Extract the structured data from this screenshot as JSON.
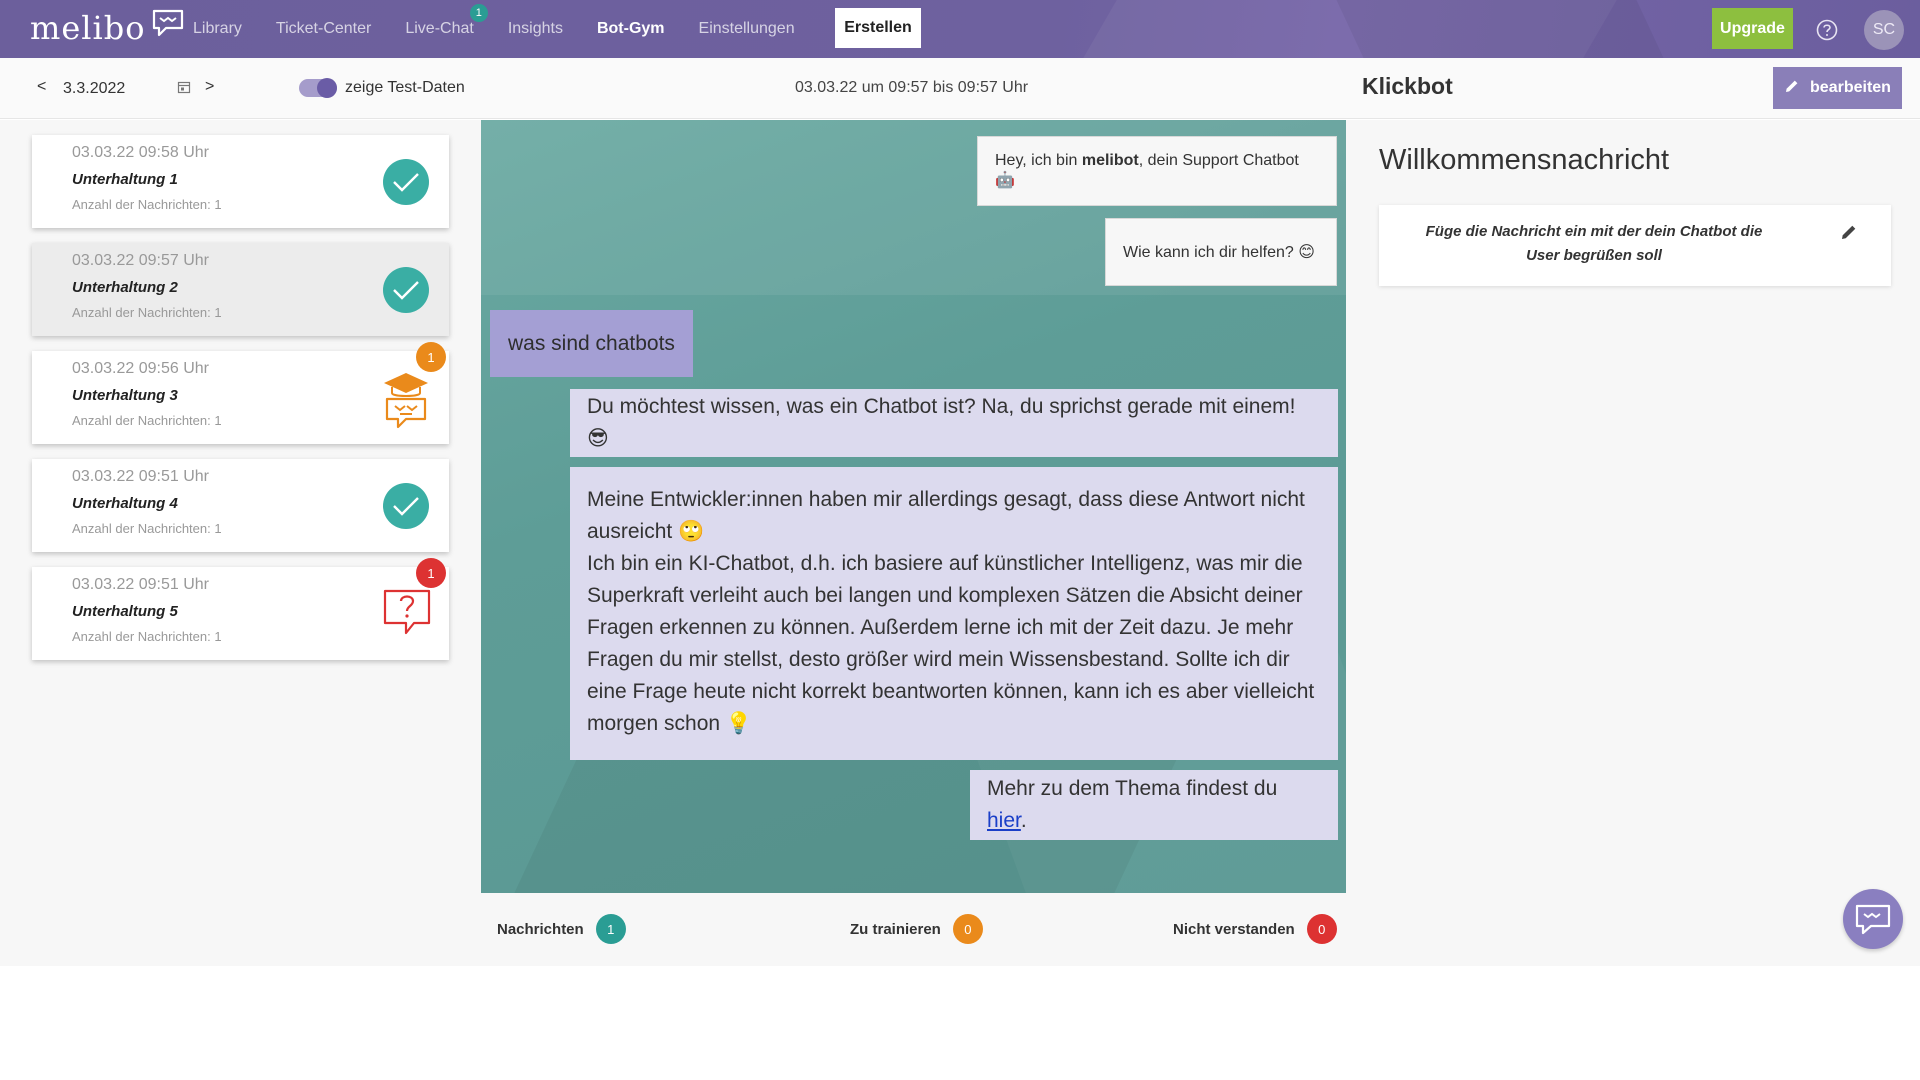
{
  "app": {
    "logo_text": "melibo"
  },
  "nav": {
    "items": [
      {
        "label": "Library",
        "bold": false
      },
      {
        "label": "Ticket-Center",
        "bold": false
      },
      {
        "label": "Live-Chat",
        "bold": false,
        "badge": "1"
      },
      {
        "label": "Insights",
        "bold": false
      },
      {
        "label": "Bot-Gym",
        "bold": true
      },
      {
        "label": "Einstellungen",
        "bold": false
      }
    ],
    "active_label": "Erstellen",
    "upgrade_label": "Upgrade",
    "avatar_initials": "SC"
  },
  "subheader": {
    "prev": "<",
    "date": "3.3.2022",
    "next": ">",
    "toggle_label": "zeige Test-Daten",
    "toggle_on": true,
    "time_range": "03.03.22 um 09:57 bis 09:57 Uhr",
    "bot_name": "Klickbot",
    "edit_label": "bearbeiten"
  },
  "conversations": [
    {
      "time": "03.03.22 09:58 Uhr",
      "title": "Unterhaltung 1",
      "count": "Anzahl der Nachrichten: 1",
      "status": "check"
    },
    {
      "time": "03.03.22 09:57 Uhr",
      "title": "Unterhaltung 2",
      "count": "Anzahl der Nachrichten: 1",
      "status": "check",
      "selected": true
    },
    {
      "time": "03.03.22 09:56 Uhr",
      "title": "Unterhaltung 3",
      "count": "Anzahl der Nachrichten: 1",
      "status": "train",
      "badge": "1"
    },
    {
      "time": "03.03.22 09:51 Uhr",
      "title": "Unterhaltung 4",
      "count": "Anzahl der Nachrichten: 1",
      "status": "check"
    },
    {
      "time": "03.03.22 09:51 Uhr",
      "title": "Unterhaltung 5",
      "count": "Anzahl der Nachrichten: 1",
      "status": "question",
      "badge": "1"
    }
  ],
  "chat": {
    "greeting_pre": "Hey, ich bin ",
    "greeting_bold": "melibot",
    "greeting_post": ", dein Support Chatbot 🤖",
    "help": "Wie kann ich dir helfen? 😊",
    "user_message": "was sind chatbots",
    "answer_1": "Du möchtest wissen, was ein Chatbot ist? Na, du sprichst gerade mit einem! 😎",
    "answer_2_line1": "Meine Entwickler:innen haben mir allerdings gesagt, dass diese Antwort nicht ausreicht 🙄",
    "answer_2_line2": "Ich bin ein KI-Chatbot, d.h. ich basiere auf künstlicher Intelligenz, was mir die Superkraft verleiht auch bei langen und komplexen Sätzen die Absicht deiner Fragen erkennen zu können. Außerdem lerne ich mit der Zeit dazu. Je mehr Fragen du mir stellst, desto größer wird mein Wissensbestand. Sollte ich dir eine Frage heute nicht korrekt beantworten können, kann ich es aber vielleicht morgen schon 💡",
    "more_pre": "Mehr zu dem Thema findest du ",
    "more_link": "hier",
    "more_post": "."
  },
  "stats": [
    {
      "label": "Nachrichten",
      "value": "1",
      "color": "#2a9d94"
    },
    {
      "label": "Zu trainieren",
      "value": "0",
      "color": "#ea8a1b"
    },
    {
      "label": "Nicht verstanden",
      "value": "0",
      "color": "#dd3232"
    }
  ],
  "welcome": {
    "title": "Willkommensnachricht",
    "text": "Füge die Nachricht ein mit der dein Chatbot die User begrüßen soll"
  },
  "colors": {
    "nav_bg": "#6e619f",
    "upgrade": "#8dbf3f",
    "teal": "#3aaea4",
    "orange": "#ea8a1b",
    "red": "#dd3232",
    "user_bubble": "#a49fd4",
    "bot_bubble": "#dcdaee"
  },
  "icons": {
    "logo": "chat-bubble-icon",
    "help": "question-circle-icon",
    "calendar": "calendar-icon",
    "edit": "pencil-icon",
    "check": "check-icon",
    "train": "graduation-cap-bot-icon",
    "question": "question-bubble-icon",
    "widget": "chat-widget-icon"
  }
}
